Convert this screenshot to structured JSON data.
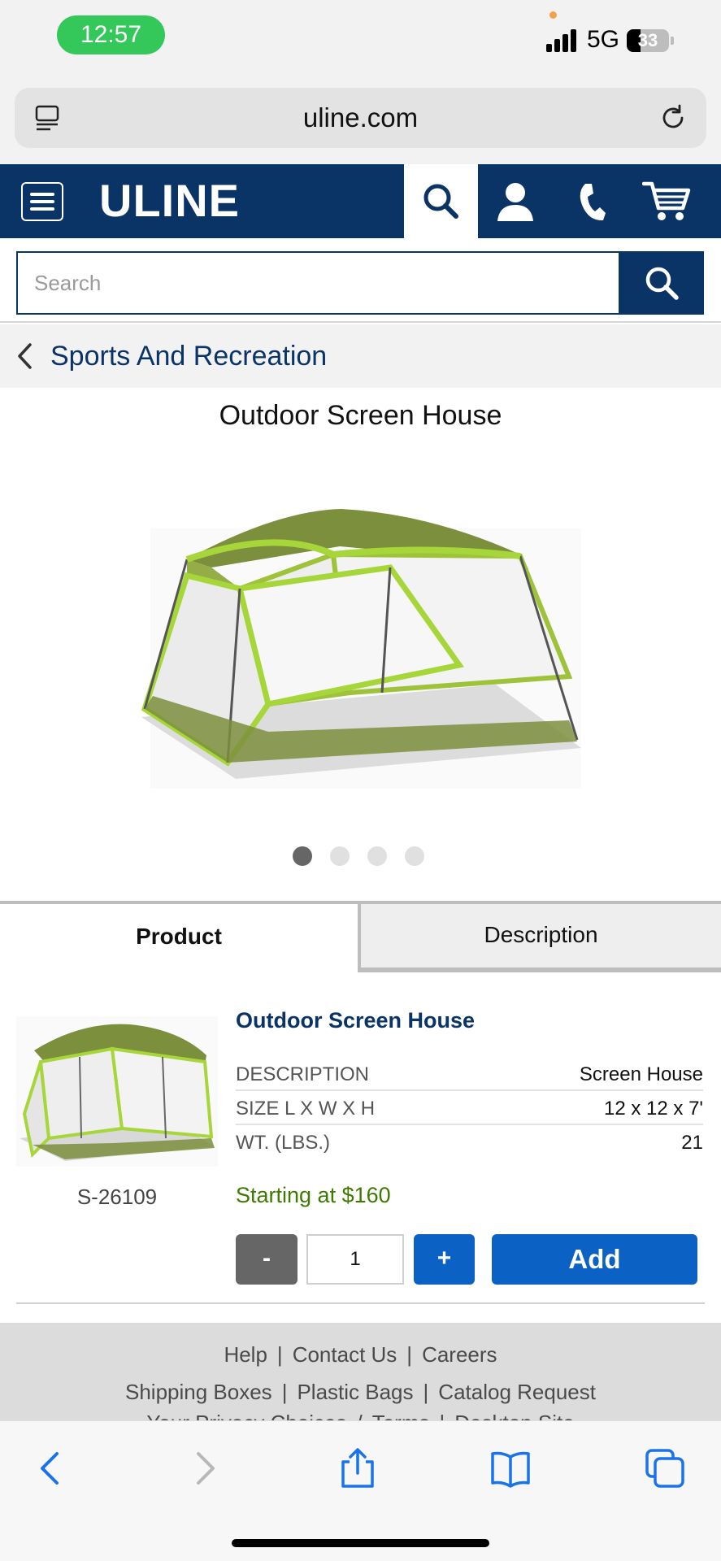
{
  "status_bar": {
    "time": "12:57",
    "network": "5G",
    "battery": "33",
    "battery_level": 0.33
  },
  "browser": {
    "url": "uline.com"
  },
  "header": {
    "brand": "ULINE"
  },
  "search": {
    "placeholder": "Search"
  },
  "breadcrumb": {
    "label": "Sports And Recreation"
  },
  "page_title": "Outdoor Screen House",
  "carousel": {
    "count": 4,
    "active": 0
  },
  "tabs": {
    "product": "Product",
    "description": "Description"
  },
  "product": {
    "name": "Outdoor Screen House",
    "sku": "S-26109",
    "specs": [
      {
        "key": "DESCRIPTION",
        "value": "Screen House"
      },
      {
        "key": "SIZE L X W X H",
        "value": "12 x 12 x 7'"
      },
      {
        "key": "WT. (LBS.)",
        "value": "21"
      }
    ],
    "price": "Starting at $160",
    "quantity": "1",
    "minus_label": "-",
    "plus_label": "+",
    "add_label": "Add"
  },
  "footer": {
    "row1": [
      "Help",
      "Contact Us",
      "Careers"
    ],
    "row2": [
      "Shipping Boxes",
      "Plastic Bags",
      "Catalog Request"
    ],
    "row3": [
      "Your Privacy Choices",
      "Terms",
      "Desktop Site"
    ],
    "separator": "|"
  },
  "colors": {
    "navy": "#0b3466",
    "blue_button": "#0b61c4",
    "price_green": "#3d7a00",
    "status_green": "#34c759"
  }
}
